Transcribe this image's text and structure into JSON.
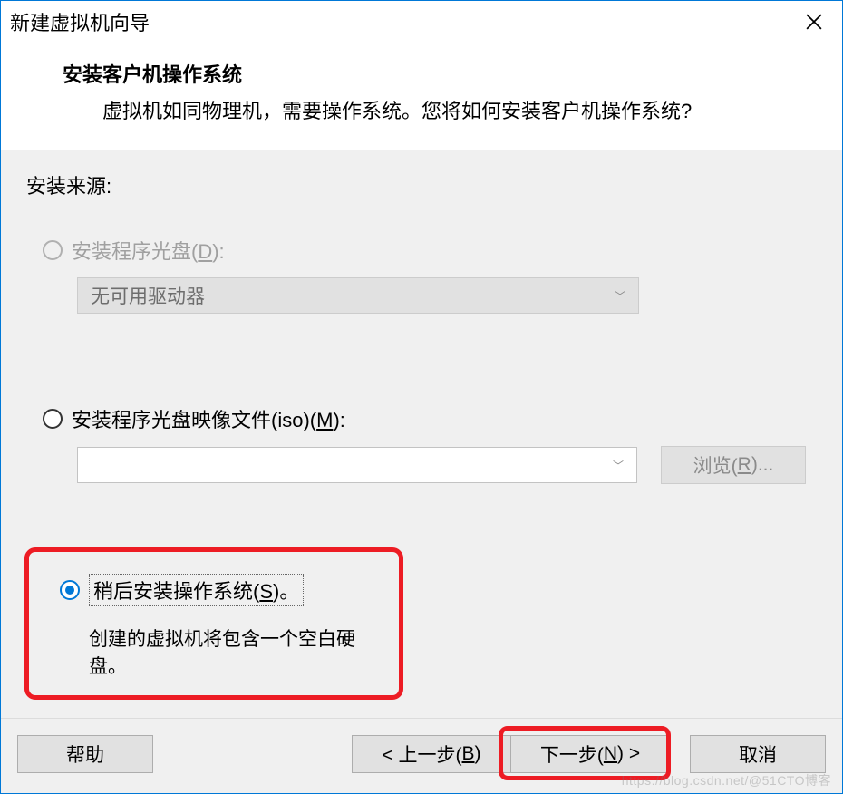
{
  "window": {
    "title": "新建虚拟机向导"
  },
  "header": {
    "title": "安装客户机操作系统",
    "subtitle": "虚拟机如同物理机，需要操作系统。您将如何安装客户机操作系统?"
  },
  "body": {
    "source_label": "安装来源:",
    "opt_disc": {
      "label_pre": "安装程序光盘(",
      "mnemonic": "D",
      "label_post": "):",
      "combo_text": "无可用驱动器"
    },
    "opt_iso": {
      "label_pre": "安装程序光盘映像文件(iso)(",
      "mnemonic": "M",
      "label_post": "):",
      "combo_text": "",
      "browse_pre": "浏览(",
      "browse_mn": "R",
      "browse_post": ")..."
    },
    "opt_later": {
      "label_pre": "稍后安装操作系统(",
      "mnemonic": "S",
      "label_post": ")。",
      "desc": "创建的虚拟机将包含一个空白硬盘。"
    }
  },
  "footer": {
    "help": "帮助",
    "back_pre": "< 上一步(",
    "back_mn": "B",
    "back_post": ")",
    "next_pre": "下一步(",
    "next_mn": "N",
    "next_post": ") >",
    "cancel": "取消"
  },
  "watermark": "https://blog.csdn.net/@51CTO博客"
}
